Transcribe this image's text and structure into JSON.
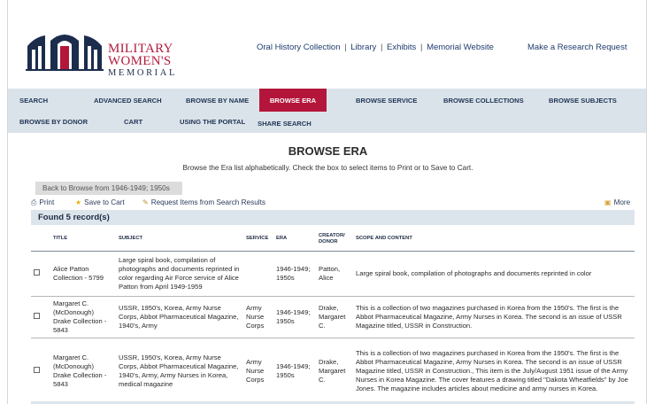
{
  "header": {
    "logo_line1": "MILITARY",
    "logo_line2": "WOMEN'S",
    "logo_line3": "MEMORIAL",
    "links": [
      "Oral History Collection",
      "Library",
      "Exhibits",
      "Memorial Website"
    ],
    "separator": "|",
    "research_link": "Make a Research Request"
  },
  "nav": {
    "row1": [
      "SEARCH",
      "ADVANCED SEARCH",
      "BROWSE BY NAME",
      "BROWSE ERA",
      "BROWSE SERVICE",
      "BROWSE COLLECTIONS",
      "BROWSE SUBJECTS"
    ],
    "row2": [
      "BROWSE BY DONOR",
      "CART",
      "USING THE PORTAL",
      "SHARE SEARCH"
    ],
    "active": "BROWSE ERA"
  },
  "main": {
    "title": "BROWSE ERA",
    "intro": "Browse the Era list alphabetically. Check the box to select items to Print or to Save to Cart.",
    "back_button": "Back to Browse from 1946-1949; 1950s",
    "toolbar": {
      "print": "Print",
      "save": "Save to Cart",
      "request": "Request Items from Search Results",
      "more": "More"
    },
    "found": "Found 5 record(s)"
  },
  "table": {
    "headers": [
      "TITLE",
      "SUBJECT",
      "SERVICE",
      "ERA",
      "CREATOR/ DONOR",
      "SCOPE AND CONTENT"
    ],
    "rows": [
      {
        "title": "Alice Patton Collection - 5799",
        "subject": "Large spiral book, compilation of photographs and documents reprinted in color regarding Air Force service of Alice Patton from April 1949-1959",
        "service": "",
        "era": "1946-1949; 1950s",
        "creator": "Patton, Alice",
        "scope": "Large spiral book, compilation of photographs and documents reprinted in color"
      },
      {
        "title": "Margaret C. (McDonough) Drake Collection - 5843",
        "subject": "USSR, 1950's, Korea, Army Nurse Corps, Abbot Pharmaceutical Magazine, 1940's, Army",
        "service": "Army Nurse Corps",
        "era": "1946-1949; 1950s",
        "creator": "Drake, Margaret C.",
        "scope": "This is a collection of two magazines purchased in Korea from the 1950's. The first is the Abbot Pharmaceutical Magazine, Army Nurses in Korea. The second is an issue of USSR Magazine titled, USSR in Construction."
      },
      {
        "title": "Margaret C. (McDonough) Drake Collection - 5843",
        "subject": "USSR, 1950's, Korea, Army Nurse Corps, Abbot Pharmaceutical Magazine, 1940's, Army, Army Nurses in Korea, medical magazine",
        "service": "Army Nurse Corps",
        "era": "1946-1949; 1950s",
        "creator": "Drake, Margaret C.",
        "scope": "This is a collection of two magazines purchased in Korea from the 1950's. The first is the Abbot Pharmaceutical Magazine, Army Nurses in Korea. The second is an issue of USSR Magazine titled, USSR in Construction., This item is the July/August 1951 issue of the Army Nurses in Korea Magazine. The cover features a drawing titled \"Dakota Wheatfields\" by Joe Jones. The magazine includes articles about medicine and army nurses in Korea."
      }
    ]
  },
  "colors": {
    "brand_red": "#b3163a",
    "navy": "#1f3555",
    "nav_bg": "#dbe3ea"
  }
}
